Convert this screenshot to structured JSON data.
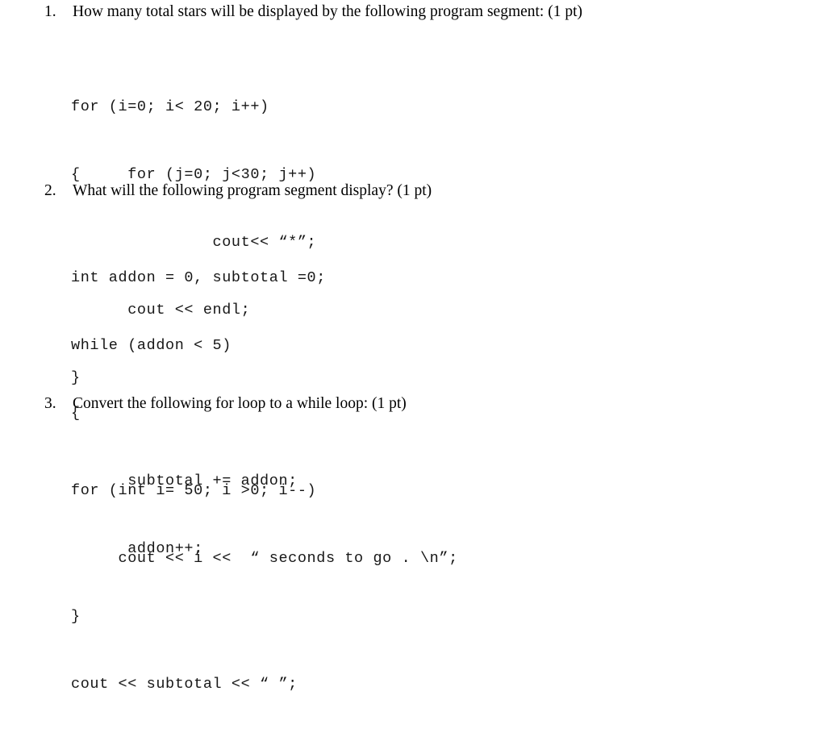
{
  "document": {
    "background_color": "#ffffff",
    "text_color": "#000000"
  },
  "questions": [
    {
      "number": "1.",
      "prompt": "How many total stars will be displayed by the following program segment: (1 pt)",
      "code_lines": [
        "for (i=0; i< 20; i++)",
        "{     for (j=0; j<30; j++)",
        "               cout<< “*”;",
        "      cout << endl;",
        "}"
      ]
    },
    {
      "number": "2.",
      "prompt": "What will the following program segment display? (1 pt)",
      "code_lines": [
        "int addon = 0, subtotal =0;",
        "while (addon < 5)",
        "{",
        "      subtotal += addon;",
        "      addon++;",
        "}",
        "cout << subtotal << “ ”;"
      ]
    },
    {
      "number": "3.",
      "prompt": "Convert the following for loop to a while loop: (1 pt)",
      "code_lines": [
        "for (int i= 50; i >0; i--)",
        "     cout << i <<  “ seconds to go . \\n”;"
      ]
    }
  ]
}
